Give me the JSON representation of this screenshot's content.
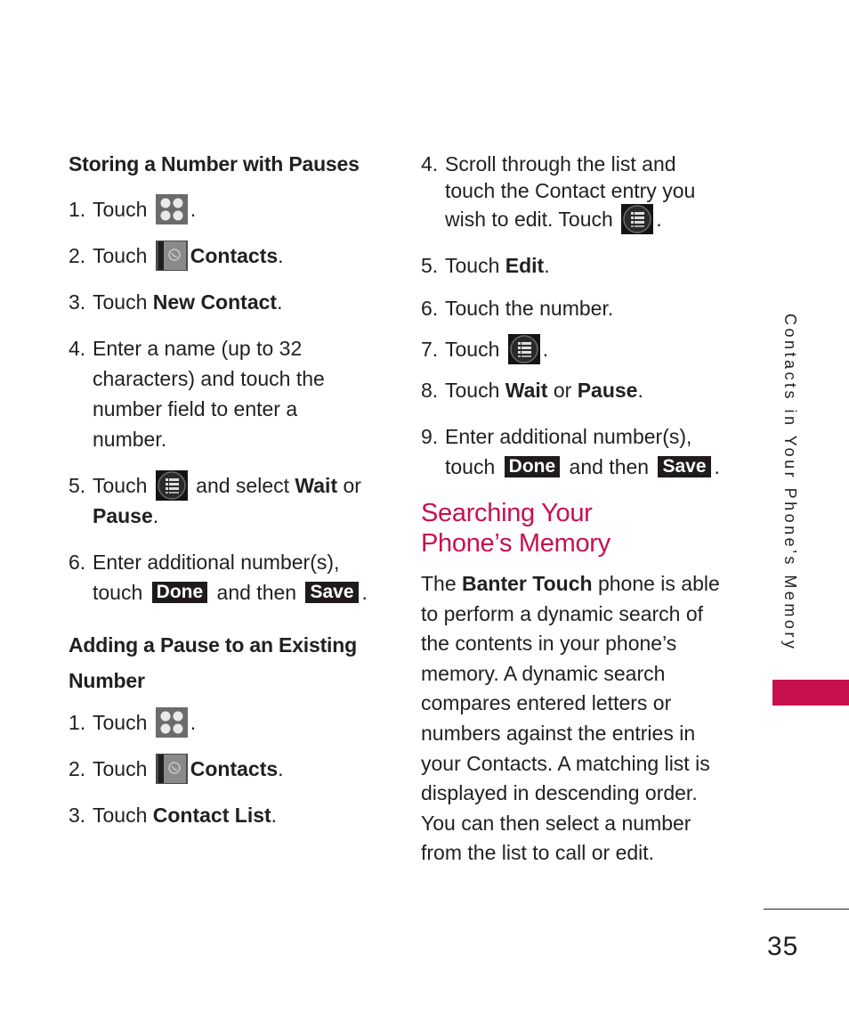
{
  "left": {
    "section1_title": "Storing a Number with Pauses",
    "section1_steps": [
      {
        "num": "1.",
        "pre": "Touch",
        "icon": "apps-grid-icon",
        "post": "."
      },
      {
        "num": "2.",
        "pre": "Touch",
        "icon": "contacts-book-icon",
        "bold": "Contacts",
        "post": "."
      },
      {
        "num": "3.",
        "pre": "Touch ",
        "bold": "New Contact",
        "post": "."
      },
      {
        "num": "4.",
        "text": "Enter a name (up to 32 characters) and touch the number field to enter a number."
      },
      {
        "num": "5.",
        "pre": "Touch",
        "icon": "menu-list-icon",
        "mid": "and select ",
        "bold1": "Wait",
        "mid2": " or ",
        "bold2": "Pause",
        "post": "."
      },
      {
        "num": "6.",
        "text": "Enter additional number(s), touch",
        "btn1": "Done",
        "mid": "and then",
        "btn2": "Save",
        "post": "."
      }
    ],
    "section2_title": "Adding a Pause to an Existing Number",
    "section2_steps": [
      {
        "num": "1.",
        "pre": "Touch",
        "icon": "apps-grid-icon",
        "post": "."
      },
      {
        "num": "2.",
        "pre": "Touch",
        "icon": "contacts-book-icon",
        "bold": "Contacts",
        "post": "."
      },
      {
        "num": "3.",
        "pre": "Touch ",
        "bold": "Contact List",
        "post": "."
      }
    ]
  },
  "right": {
    "steps": [
      {
        "num": "4.",
        "text": "Scroll through the list and touch the Contact entry you wish to edit. Touch",
        "icon": "menu-list-icon",
        "post": "."
      },
      {
        "num": "5.",
        "pre": "Touch ",
        "bold": "Edit",
        "post": "."
      },
      {
        "num": "6.",
        "text": "Touch the number."
      },
      {
        "num": "7.",
        "pre": "Touch",
        "icon": "menu-list-icon",
        "post": "."
      },
      {
        "num": "8.",
        "pre": "Touch ",
        "bold1": "Wait",
        "mid": " or ",
        "bold2": "Pause",
        "post": "."
      },
      {
        "num": "9.",
        "text": "Enter additional number(s), touch",
        "btn1": "Done",
        "mid": "and then",
        "btn2": "Save",
        "post": "."
      }
    ],
    "heading": "Searching Your Phone’s Memory",
    "para_pre": "The ",
    "para_bold": "Banter Touch",
    "para_post": " phone is able to perform a dynamic search of the contents in your phone’s memory. A dynamic search compares entered letters or numbers against the entries in your Contacts. A matching list is displayed in descending order. You can then select a number from the list to call or edit."
  },
  "side_label": "Contacts in Your Phone’s Memory",
  "page_number": "35",
  "colors": {
    "accent": "#c8104e",
    "text": "#231f20",
    "button_bg": "#1f1a1b"
  }
}
